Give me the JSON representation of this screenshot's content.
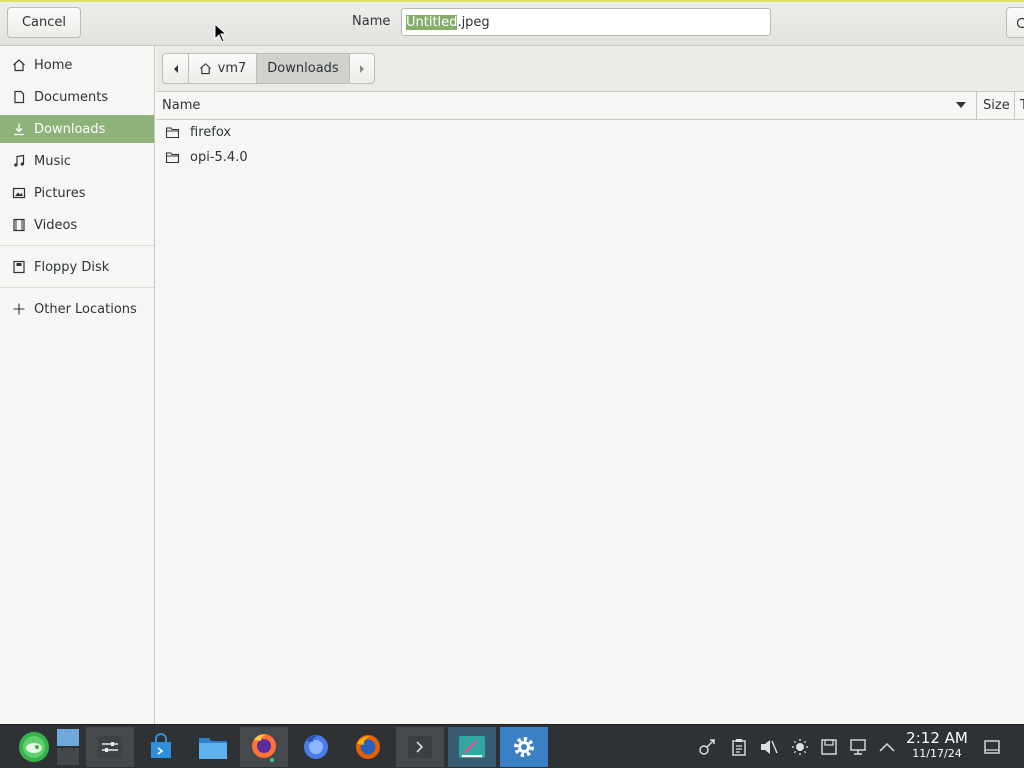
{
  "header": {
    "cancel_label": "Cancel",
    "name_label": "Name",
    "filename_selected": "Untitled",
    "filename_ext": ".jpeg"
  },
  "sidebar": {
    "items": [
      {
        "label": "Home",
        "icon": "home-icon"
      },
      {
        "label": "Documents",
        "icon": "document-icon"
      },
      {
        "label": "Downloads",
        "icon": "download-icon",
        "active": true
      },
      {
        "label": "Music",
        "icon": "music-icon"
      },
      {
        "label": "Pictures",
        "icon": "picture-icon"
      },
      {
        "label": "Videos",
        "icon": "video-icon"
      },
      {
        "label": "Floppy Disk",
        "icon": "floppy-icon"
      },
      {
        "label": "Other Locations",
        "icon": "plus-icon"
      }
    ]
  },
  "pathbar": {
    "segments": [
      "vm7",
      "Downloads"
    ]
  },
  "columns": {
    "name": "Name",
    "size": "Size",
    "type": "T"
  },
  "files": [
    {
      "name": "firefox",
      "icon": "folder-icon"
    },
    {
      "name": "opi-5.4.0",
      "icon": "folder-icon"
    }
  ],
  "taskbar": {
    "time": "2:12 AM",
    "date": "11/17/24"
  },
  "colors": {
    "accent": "#8db27a",
    "selection": "#86ae6b",
    "taskbar_bg": "#2f3234",
    "focus_task": "#3b80c5"
  }
}
